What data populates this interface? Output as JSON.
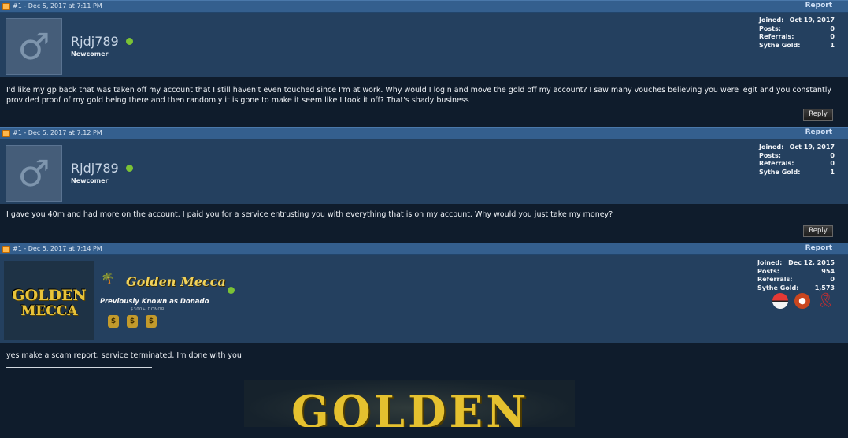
{
  "posts": [
    {
      "meta": "#1 - Dec 5, 2017 at 7:11 PM",
      "report_label": "Report",
      "username": "Rjdj789",
      "usertitle": "Newcomer",
      "stats": {
        "joined_label": "Joined:",
        "joined": "Oct 19, 2017",
        "posts_label": "Posts:",
        "posts": "0",
        "referrals_label": "Referrals:",
        "referrals": "0",
        "gold_label": "Sythe Gold:",
        "gold": "1"
      },
      "message": "I'd like my gp back that was taken off my account that I still haven't even touched since I'm at work. Why would I login and move the gold off my account? I saw many vouches believing you were legit and you constantly provided proof of my gold being there and then randomly it is gone to make it seem like I took it off? That's shady business",
      "reply_label": "Reply",
      "avatar_icon": "male-symbol-icon"
    },
    {
      "meta": "#1 - Dec 5, 2017 at 7:12 PM",
      "report_label": "Report",
      "username": "Rjdj789",
      "usertitle": "Newcomer",
      "stats": {
        "joined_label": "Joined:",
        "joined": "Oct 19, 2017",
        "posts_label": "Posts:",
        "posts": "0",
        "referrals_label": "Referrals:",
        "referrals": "0",
        "gold_label": "Sythe Gold:",
        "gold": "1"
      },
      "message": "I gave you 40m and had more on the account. I paid you for a service entrusting you with everything that is on my account. Why would you just take my money?",
      "reply_label": "Reply",
      "avatar_icon": "male-symbol-icon"
    },
    {
      "meta": "#1 - Dec 5, 2017 at 7:14 PM",
      "report_label": "Report",
      "username": "Golden Mecca",
      "avatar_line1": "GOLDEN",
      "avatar_line2": "MECCA",
      "previously_known": "Previously Known as Donado",
      "donor_label": "$300+ DONOR",
      "stats": {
        "joined_label": "Joined:",
        "joined": "Dec 12, 2015",
        "posts_label": "Posts:",
        "posts": "954",
        "referrals_label": "Referrals:",
        "referrals": "0",
        "gold_label": "Sythe Gold:",
        "gold": "1,573"
      },
      "message": "yes make a scam report, service terminated. Im done with you",
      "signature_banner": "GOLDEN"
    }
  ],
  "colors": {
    "header_bar": "#345f8e",
    "userbar": "#24405f",
    "body_bg": "#0f1c2c",
    "online": "#7bc235",
    "gold_text": "#e5c12f"
  }
}
